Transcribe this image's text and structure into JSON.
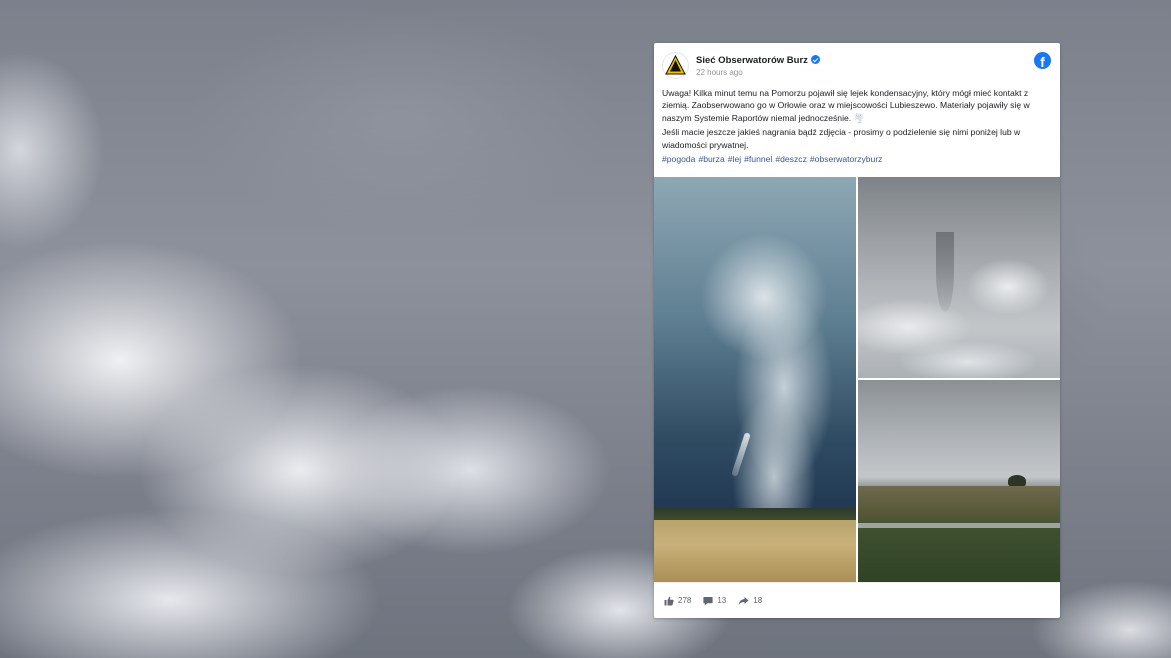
{
  "post": {
    "page_name": "Sieć Obserwatorów Burz",
    "timestamp": "22 hours ago",
    "paragraph_1": "Uwaga! Kilka minut temu na Pomorzu pojawił się lejek kondensacyjny, który mógł mieć kontakt z ziemią. Zaobserwowano go w Orłowie oraz w miejscowości Lubieszewo. Materiały pojawiły się w naszym Systemie Raportów niemal jednocześnie. 🌪️",
    "paragraph_2": "Jeśli macie jeszcze jakieś nagrania bądź zdjęcia - prosimy o podzielenie się nimi poniżej lub w wiadomości prywatnej.",
    "hashtags": [
      "#pogoda",
      "#burza",
      "#lej",
      "#funnel",
      "#deszcz",
      "#obserwatorzyburz"
    ],
    "reactions": "278",
    "comments": "13",
    "shares": "18"
  },
  "icons": {
    "avatar": "warning-triangle-logo",
    "verified": "verified-badge-icon",
    "platform": "facebook-icon",
    "like": "thumbs-up-icon",
    "comment": "comment-icon",
    "share": "share-arrow-icon"
  },
  "colors": {
    "accent": "#1877f2",
    "hashtag": "#385898"
  }
}
